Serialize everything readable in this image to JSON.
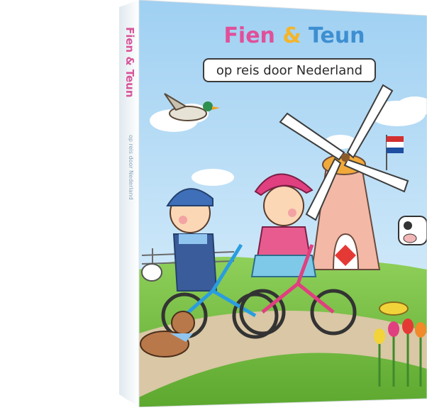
{
  "cover": {
    "title_part1": "Fien",
    "title_amp": "&",
    "title_part2": "Teun",
    "subtitle": "op reis door Nederland"
  },
  "spine": {
    "title": "Fien & Teun",
    "subtitle": "op reis door Nederland"
  },
  "colors": {
    "sky": "#bfe0f6",
    "grass": "#7cc243",
    "title_pink": "#e0509a",
    "title_blue": "#3e8fd1",
    "title_amp": "#f4b52a"
  }
}
